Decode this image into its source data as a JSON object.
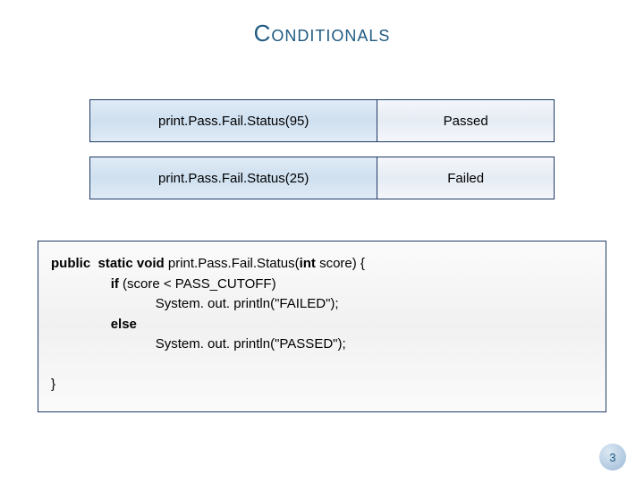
{
  "title": "Conditionals",
  "rows": [
    {
      "call": "print.Pass.Fail.Status(95)",
      "result": "Passed"
    },
    {
      "call": "print.Pass.Fail.Status(25)",
      "result": "Failed"
    }
  ],
  "code": {
    "sig_prefix": "public  static void ",
    "sig_method": "print.Pass.Fail.Status(",
    "sig_param_kw": "int ",
    "sig_param_rest": "score) {",
    "if_kw": "if ",
    "if_cond": "(score < PASS_CUTOFF)",
    "stmt_failed": "System. out. println(\"FAILED\");",
    "else_kw": "else",
    "stmt_passed": "System. out. println(\"PASSED\");",
    "close": "}"
  },
  "page_number": "3"
}
